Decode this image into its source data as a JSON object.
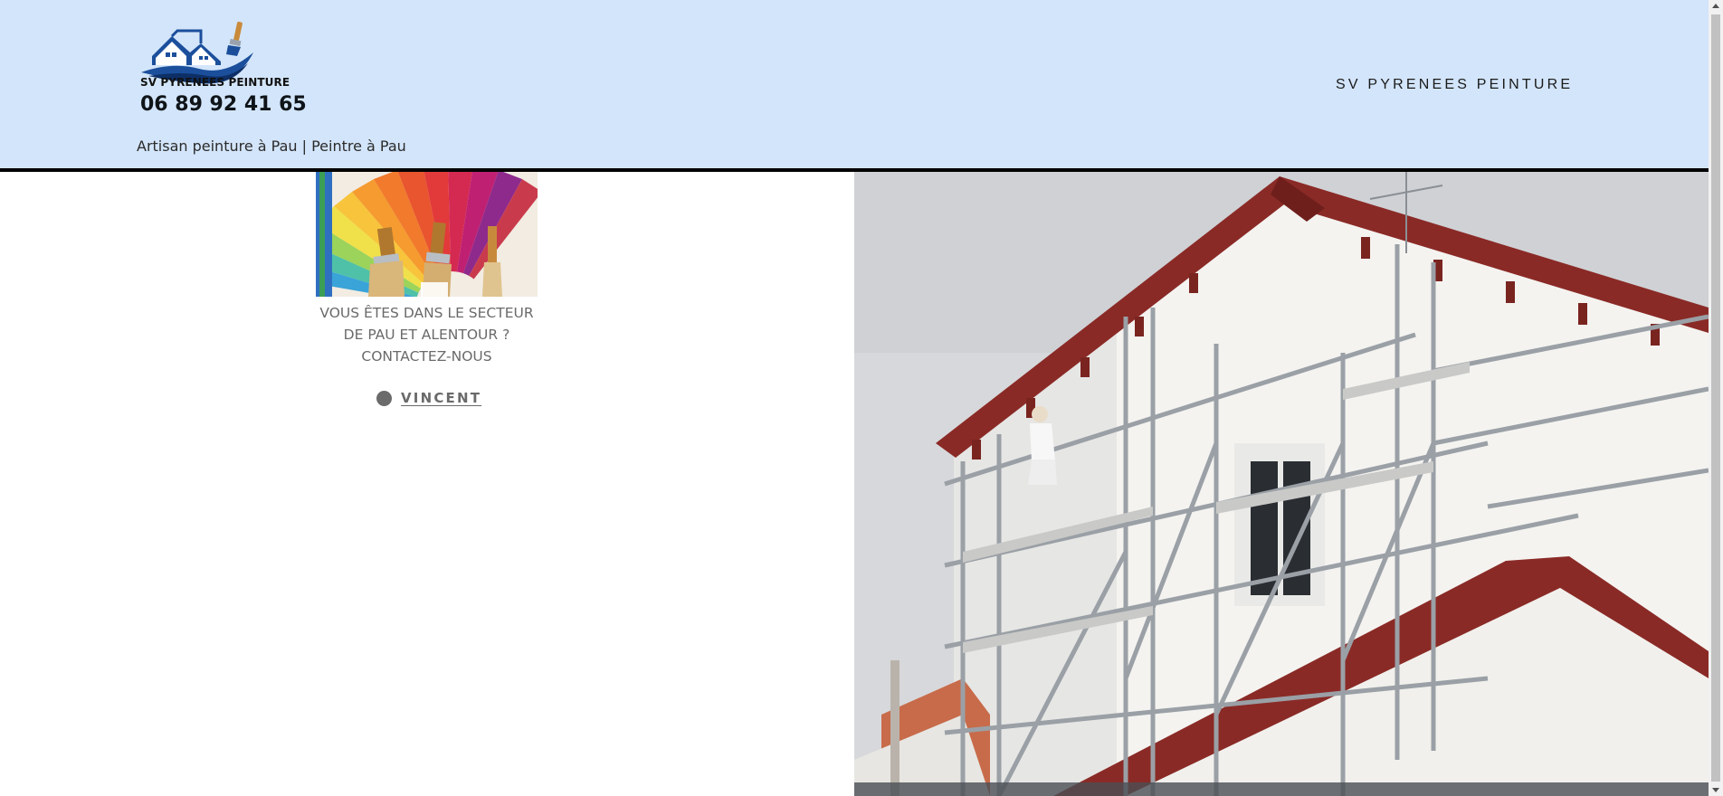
{
  "header": {
    "logo_text": "SV PYRENEES PEINTURE",
    "phone": "06 89 92 41 65",
    "tagline": "Artisan peinture à Pau | Peintre à Pau",
    "nav_title": "SV PYRENEES PEINTURE"
  },
  "post": {
    "image_icon": "color-palette-brushes-image",
    "excerpt": "VOUS ÊTES DANS LE SECTEUR DE PAU ET ALENTOUR ? CONTACTEZ-NOUS",
    "author_icon": "avatar-icon",
    "author": "VINCENT"
  },
  "hero": {
    "image_icon": "house-scaffolding-photo"
  },
  "colors": {
    "header_bg": "#d3e5fa",
    "header_border": "#000000",
    "logo_blue": "#1b4f9c",
    "roof_red": "#8a2a26",
    "muted_text": "#6a6a6a"
  }
}
